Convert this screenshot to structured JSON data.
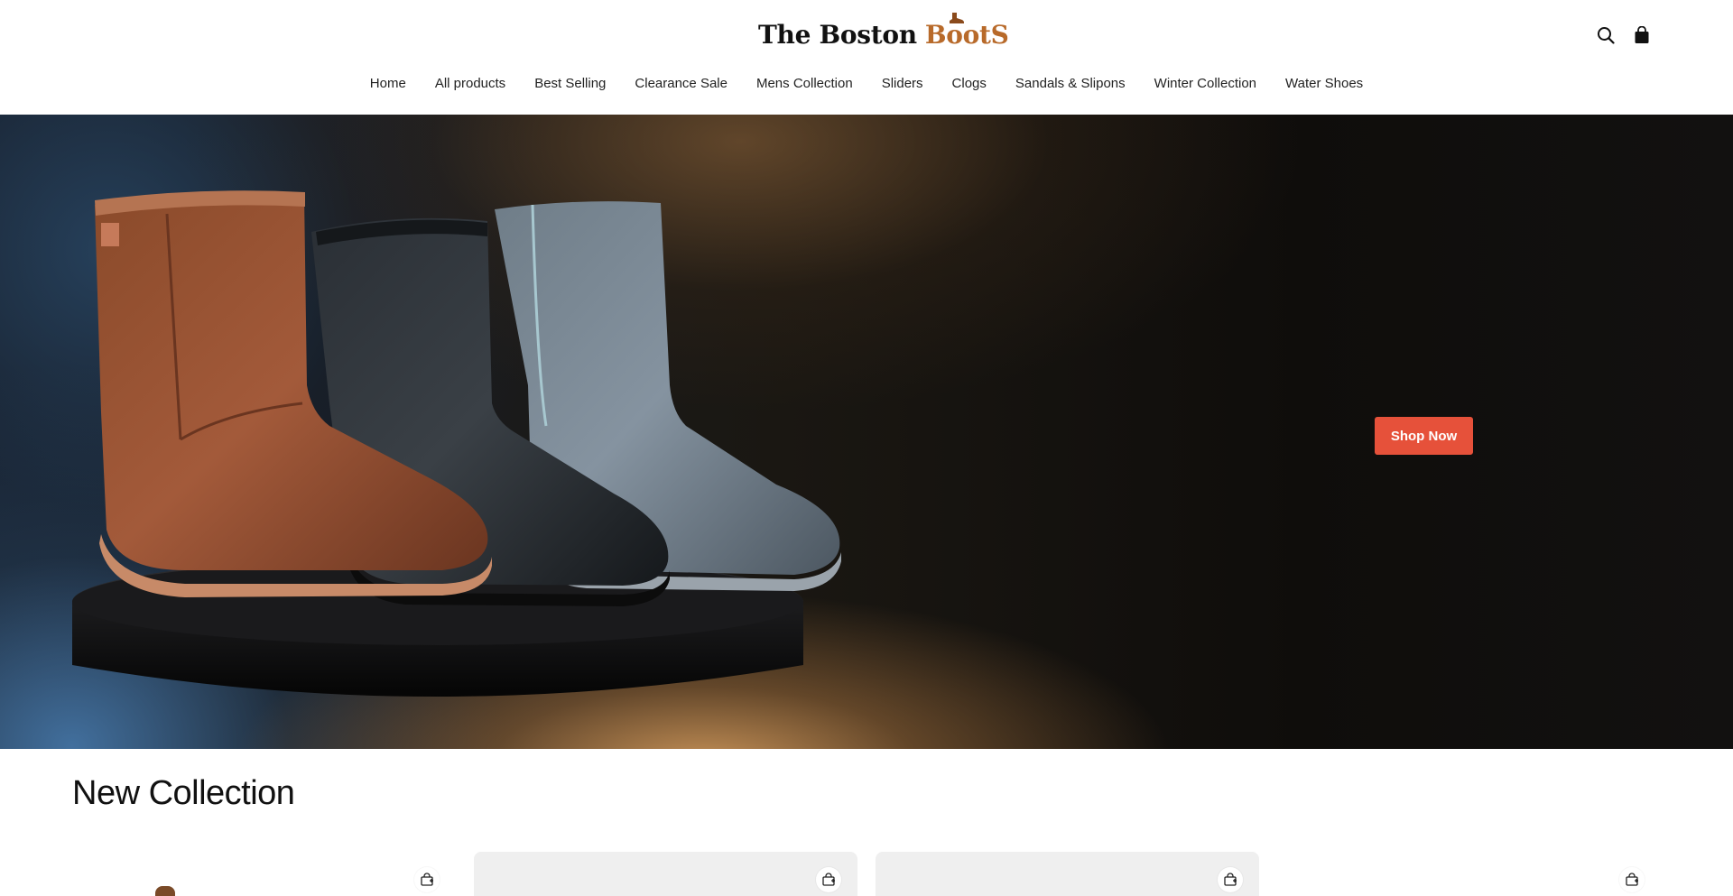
{
  "header": {
    "logo_main": "The Boston",
    "logo_accent": "BootS",
    "icons": {
      "search": "search-icon",
      "cart": "cart-icon"
    }
  },
  "nav": {
    "items": [
      {
        "label": "Home"
      },
      {
        "label": "All products"
      },
      {
        "label": "Best Selling"
      },
      {
        "label": "Clearance Sale"
      },
      {
        "label": "Mens Collection"
      },
      {
        "label": "Sliders"
      },
      {
        "label": "Clogs"
      },
      {
        "label": "Sandals & Slipons"
      },
      {
        "label": "Winter Collection"
      },
      {
        "label": "Water Shoes"
      }
    ]
  },
  "hero": {
    "button_label": "Shop Now",
    "button_color": "#e6513a"
  },
  "collection": {
    "title": "New Collection",
    "cards_icon": "bag-add-icon"
  },
  "colors": {
    "accent": "#e6513a",
    "logo_accent": "#b86a2a"
  }
}
